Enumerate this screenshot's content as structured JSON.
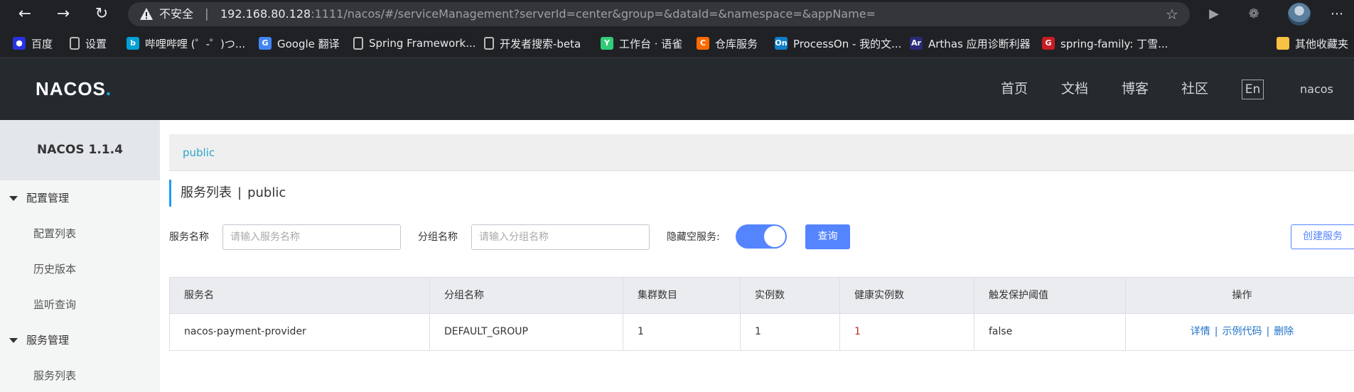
{
  "browser": {
    "insecure_label": "不安全",
    "url_host": "192.168.80.128",
    "url_rest": ":1111/nacos/#/serviceManagement?serverId=center&group=&dataId=&namespace=&appName=",
    "icons": [
      "back-icon",
      "forward-icon",
      "reload-icon",
      "warning-icon",
      "star-add-icon",
      "play-icon",
      "extensions-icon",
      "menu-icon"
    ]
  },
  "bookmarks": [
    {
      "label": "百度",
      "icon": "baidu-icon",
      "color": "#2932e1"
    },
    {
      "label": "设置",
      "icon": "file-icon",
      "color": "#5f6368"
    },
    {
      "label": "哔哩哔哩 (゜-゜)つ...",
      "icon": "bilibili-icon",
      "color": "#00a1d6"
    },
    {
      "label": "Google 翻译",
      "icon": "google-translate-icon",
      "color": "#4285f4"
    },
    {
      "label": "Spring Framework...",
      "icon": "file-icon",
      "color": "#5f6368"
    },
    {
      "label": "开发者搜索-beta",
      "icon": "file-icon",
      "color": "#5f6368"
    },
    {
      "label": "工作台 · 语雀",
      "icon": "yuque-icon",
      "color": "#31cc79"
    },
    {
      "label": "仓库服务",
      "icon": "aliyun-icon",
      "color": "#ff6a00"
    },
    {
      "label": "ProcessOn - 我的文...",
      "icon": "processon-icon",
      "color": "#0f7ec8"
    },
    {
      "label": "Arthas 应用诊断利器",
      "icon": "arthas-icon",
      "color": "#2b2b7a"
    },
    {
      "label": "spring-family: 丁雪...",
      "icon": "gitee-icon",
      "color": "#c71d23"
    },
    {
      "label": "其他收藏夹",
      "icon": "folder-icon",
      "color": "#f9c142"
    }
  ],
  "header": {
    "logo": "NACOS",
    "nav": [
      "首页",
      "文档",
      "博客",
      "社区"
    ],
    "lang": "En",
    "user": "nacos"
  },
  "sidebar": {
    "title": "NACOS 1.1.4",
    "groups": [
      {
        "label": "配置管理",
        "items": [
          "配置列表",
          "历史版本",
          "监听查询"
        ]
      },
      {
        "label": "服务管理",
        "items": [
          "服务列表"
        ]
      }
    ]
  },
  "main": {
    "namespace": "public",
    "title": "服务列表",
    "title_ns": "public",
    "filters": {
      "service_label": "服务名称",
      "service_placeholder": "请输入服务名称",
      "group_label": "分组名称",
      "group_placeholder": "请输入分组名称",
      "hide_empty_label": "隐藏空服务:",
      "hide_empty_on": true,
      "query_button": "查询",
      "create_button": "创建服务"
    },
    "table": {
      "columns": [
        "服务名",
        "分组名称",
        "集群数目",
        "实例数",
        "健康实例数",
        "触发保护阈值",
        "操作"
      ],
      "rows": [
        {
          "name": "nacos-payment-provider",
          "group": "DEFAULT_GROUP",
          "clusters": "1",
          "instances": "1",
          "healthy": "1",
          "threshold": "false",
          "ops": [
            "详情",
            "示例代码",
            "删除"
          ]
        }
      ]
    }
  }
}
